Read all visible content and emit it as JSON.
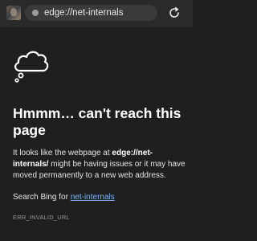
{
  "browser": {
    "url": "edge://net-internals",
    "icons": {
      "profile": "profile-avatar",
      "site_info": "site-info-icon",
      "refresh": "refresh-icon"
    }
  },
  "error": {
    "icon": "cloud-thought-icon",
    "title": "Hmmm… can't reach this page",
    "desc_before": "It looks like the webpage at ",
    "desc_url": "edge://net-internals/",
    "desc_after": " might be having issues or it may have moved permanently to a new web address.",
    "search_prefix": "Search Bing for ",
    "search_link": "net-internals",
    "code": "ERR_INVALID_URL"
  },
  "colors": {
    "background": "#1f1f1f",
    "topbar": "#2a2a2a",
    "address_bar": "#3a3a3a",
    "link": "#7fb2ff",
    "muted": "#9a9a9a"
  }
}
